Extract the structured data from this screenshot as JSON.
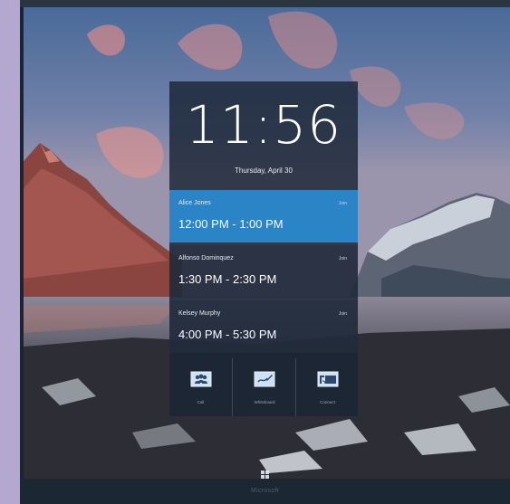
{
  "clock": {
    "time": "11:56",
    "date": "Thursday, April 30"
  },
  "meetings": [
    {
      "organizer": "Alice Jones",
      "time": "12:00 PM - 1:00 PM",
      "join_label": "Join"
    },
    {
      "organizer": "Alfonso Dominquez",
      "time": "1:30 PM - 2:30 PM",
      "join_label": "Join"
    },
    {
      "organizer": "Kelsey Murphy",
      "time": "4:00 PM - 5:30 PM",
      "join_label": "Join"
    }
  ],
  "actions": [
    {
      "label": "Call",
      "icon": "people-icon"
    },
    {
      "label": "Whiteboard",
      "icon": "whiteboard-icon"
    },
    {
      "label": "Connect",
      "icon": "connect-icon"
    }
  ],
  "device": {
    "brand": "Microsoft",
    "logo": "windows-logo-icon"
  },
  "colors": {
    "active_meeting": "#2b84c6",
    "bezel": "#1c2734",
    "side_band": "#b4a7d0"
  }
}
